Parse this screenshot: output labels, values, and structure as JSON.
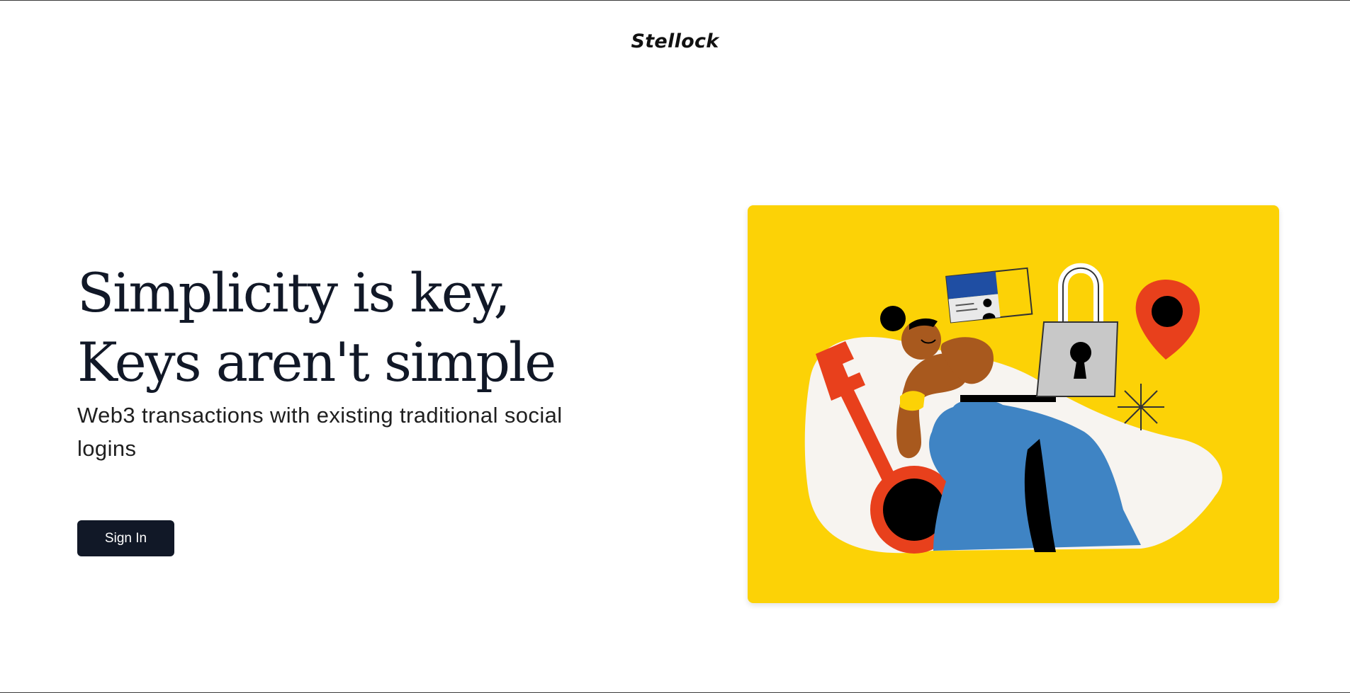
{
  "brand": {
    "name": "Stellock"
  },
  "hero": {
    "headline_line1": "Simplicity is key,",
    "headline_line2": "Keys aren't simple",
    "subtitle": "Web3 transactions with existing traditional social logins",
    "signin_label": "Sign In"
  },
  "illustration": {
    "background_color": "#fcd206",
    "icons": [
      "person-with-laptop-icon",
      "key-icon",
      "padlock-icon",
      "id-card-icon",
      "location-pin-icon",
      "sparkle-icon"
    ]
  },
  "colors": {
    "button_bg": "#111827",
    "text_primary": "#111827",
    "accent_red": "#e8401c",
    "accent_blue": "#3f84c4"
  }
}
